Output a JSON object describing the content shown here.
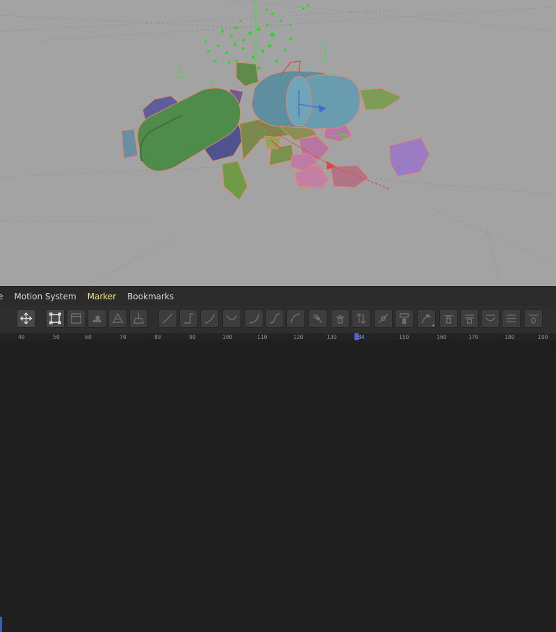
{
  "menu": [
    {
      "label": "e",
      "highlight": false,
      "truncated": true
    },
    {
      "label": "Motion System",
      "highlight": false
    },
    {
      "label": "Marker",
      "highlight": true
    },
    {
      "label": "Bookmarks",
      "highlight": false
    }
  ],
  "toolbar_buttons": [
    {
      "name": "move-tool-icon",
      "active": true
    },
    {
      "name": "frame-selected-icon",
      "active": true
    },
    {
      "name": "film-strip-icon",
      "active": false
    },
    {
      "name": "stamp-icon",
      "active": false
    },
    {
      "name": "triangle-group-icon",
      "active": false
    },
    {
      "name": "broom-icon",
      "active": false
    },
    {
      "name": "linear-interpolation-icon",
      "active": false
    },
    {
      "name": "step-interpolation-icon",
      "active": false
    },
    {
      "name": "ease-in-icon",
      "active": false
    },
    {
      "name": "dip-curve-icon",
      "active": false
    },
    {
      "name": "ease-out-curve-icon",
      "active": false
    },
    {
      "name": "s-curve-icon",
      "active": false
    },
    {
      "name": "ease-curve-icon",
      "active": false
    },
    {
      "name": "break-tangent-icon",
      "active": false
    },
    {
      "name": "tangent-lock-icon",
      "active": false
    },
    {
      "name": "tangent-up-down-icon",
      "active": false
    },
    {
      "name": "unify-tangent-icon",
      "active": false
    },
    {
      "name": "paint-roller-icon",
      "active": false
    },
    {
      "name": "keyframe-snap-icon",
      "active": false
    },
    {
      "name": "lock-keys-icon",
      "active": false
    },
    {
      "name": "lock-range-icon",
      "active": false
    },
    {
      "name": "clamp-icon",
      "active": false
    },
    {
      "name": "overshoot-icon",
      "active": false
    },
    {
      "name": "zero-value-icon",
      "active": false
    }
  ],
  "ruler": {
    "ticks": [
      "40",
      "50",
      "60",
      "70",
      "80",
      "90",
      "100",
      "110",
      "120",
      "130",
      "134",
      "150",
      "160",
      "170",
      "180",
      "190"
    ],
    "current_frame": "134"
  },
  "colors": {
    "viewport_bg": "#a3a3a3",
    "menu_highlight": "#f2e58a",
    "playhead": "#4f63d8",
    "particles": "#22dd22"
  }
}
